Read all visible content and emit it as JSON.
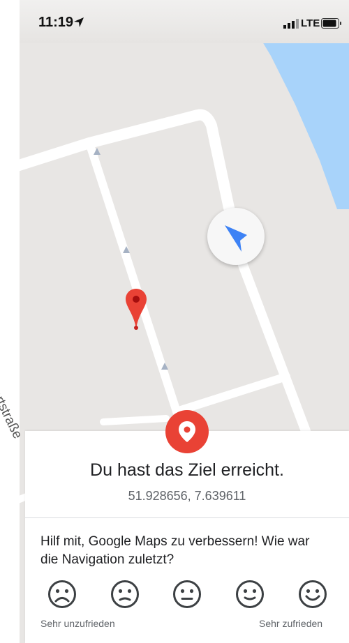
{
  "status_bar": {
    "time": "11:19",
    "network": "LTE"
  },
  "map": {
    "street_label": "ckertstraße",
    "colors": {
      "land": "#e8e6e4",
      "water": "#a8d3fa",
      "road": "#ffffff",
      "pin": "#e94235",
      "nav_arrow": "#3d82f5"
    }
  },
  "arrival": {
    "title": "Du hast das Ziel erreicht.",
    "coordinates": "51.928656, 7.639611"
  },
  "feedback": {
    "question": "Hilf mit, Google Maps zu verbessern! Wie war die Navigation zuletzt?",
    "scale_low_label": "Sehr unzufrieden",
    "scale_high_label": "Sehr zufrieden",
    "ratings": [
      "very-dissatisfied-icon",
      "dissatisfied-icon",
      "neutral-icon",
      "satisfied-icon",
      "very-satisfied-icon"
    ]
  }
}
